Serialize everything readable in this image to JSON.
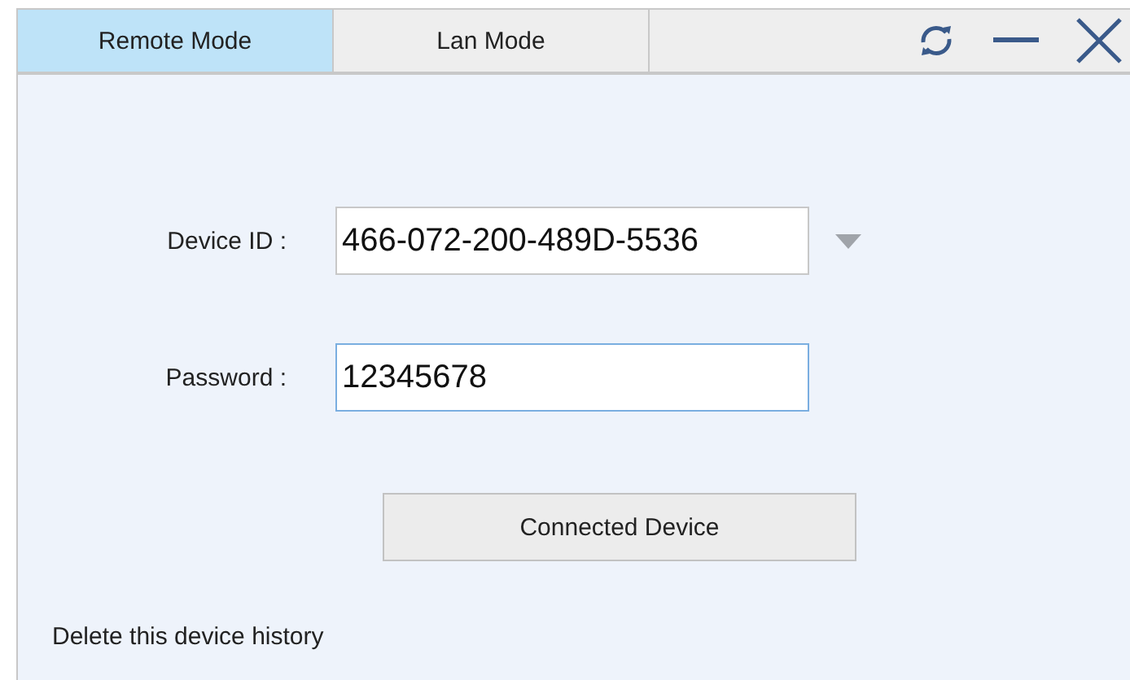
{
  "tabs": [
    {
      "label": "Remote Mode",
      "selected": true
    },
    {
      "label": "Lan Mode",
      "selected": false
    }
  ],
  "fields": [
    {
      "kind": "dropdown",
      "label": "Device ID :",
      "value": "466-072-200-489D-5536",
      "focused": false
    },
    {
      "kind": "text",
      "label": "Password :",
      "value": "12345678",
      "focused": true
    }
  ],
  "connect_button": "Connected Device",
  "delete_link": "Delete this device history"
}
